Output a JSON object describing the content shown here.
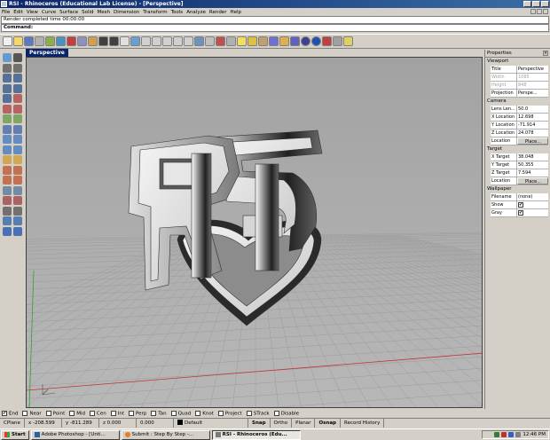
{
  "window": {
    "title": "RSI - Rhinoceros (Educational Lab License) - [Perspective]"
  },
  "menu": [
    "File",
    "Edit",
    "View",
    "Curve",
    "Surface",
    "Solid",
    "Mesh",
    "Dimension",
    "Transform",
    "Tools",
    "Analyze",
    "Render",
    "Help"
  ],
  "history": {
    "text": "Render completed time  00:00:00"
  },
  "command": {
    "label": "Command:"
  },
  "viewport": {
    "label": "Perspective"
  },
  "properties": {
    "title": "Properties",
    "viewport_section": "Viewport",
    "viewport_rows": [
      {
        "label": "Title",
        "value": "Perspective",
        "dim": false
      },
      {
        "label": "Width",
        "value": "1085",
        "dim": true
      },
      {
        "label": "Height",
        "value": "848",
        "dim": true
      },
      {
        "label": "Projection",
        "value": "Perspe...",
        "dim": false
      }
    ],
    "camera_section": "Camera",
    "camera_rows": [
      {
        "label": "Lens Len...",
        "value": "50.0"
      },
      {
        "label": "X Location",
        "value": "12.698"
      },
      {
        "label": "Y Location",
        "value": "-71.914"
      },
      {
        "label": "Z Location",
        "value": "24.078"
      }
    ],
    "camera_place_label": "Location",
    "camera_place_btn": "Place...",
    "target_section": "Target",
    "target_rows": [
      {
        "label": "X Target",
        "value": "38.048"
      },
      {
        "label": "Y Target",
        "value": "50.355"
      },
      {
        "label": "Z Target",
        "value": "7.594"
      }
    ],
    "target_place_label": "Location",
    "target_place_btn": "Place...",
    "wallpaper_section": "Wallpaper",
    "wallpaper_filename_label": "Filename",
    "wallpaper_filename_value": "(none)",
    "wallpaper_show_label": "Show",
    "wallpaper_gray_label": "Gray",
    "check_mark": "✔"
  },
  "osnap": {
    "items": [
      "End",
      "Near",
      "Point",
      "Mid",
      "Cen",
      "Int",
      "Perp",
      "Tan",
      "Quad",
      "Knot",
      "Project",
      "STrack",
      "Disable"
    ],
    "checked": "✔"
  },
  "status": {
    "cplane": "CPlane",
    "x": "x -208.599",
    "y": "y -811.289",
    "z": "z 0.000",
    "extra": "0.000",
    "layer": "Default",
    "snap": "Snap",
    "ortho": "Ortho",
    "planar": "Planar",
    "osnap": "Osnap",
    "record": "Record History"
  },
  "taskbar": {
    "start": "Start",
    "tasks": [
      {
        "label": "Adobe Photoshop - [Unti...",
        "active": false
      },
      {
        "label": "Submit : Step By Step -...",
        "active": false
      },
      {
        "label": "RSI - Rhinoceros (Edu...",
        "active": true
      }
    ],
    "clock": "12:46 PM"
  },
  "colors": {
    "accent": "#0a246a",
    "grid_red": "#c33333",
    "grid_green": "#33a033"
  },
  "icons": {
    "toolbar": [
      "new-file-icon",
      "open-file-icon",
      "save-icon",
      "print-icon",
      "import-icon",
      "export-icon",
      "cut-icon",
      "copy-icon",
      "paste-icon",
      "undo-icon",
      "redo-icon",
      "pan-icon",
      "rotate-view-icon",
      "zoom-window-icon",
      "zoom-extents-icon",
      "zoom-selected-icon",
      "zoom-in-icon",
      "zoom-out-icon",
      "four-viewports-icon",
      "grid-icon",
      "cplane-icon",
      "mesh-icon",
      "light-bulb-icon",
      "layer-icon",
      "properties-icon",
      "select-icon",
      "lock-icon",
      "material-icon",
      "shaded-sphere-icon",
      "render-sphere-icon",
      "render-icon",
      "options-icon",
      "help-icon"
    ]
  }
}
